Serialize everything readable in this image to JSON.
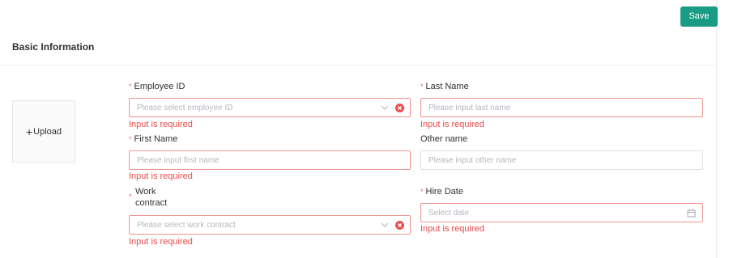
{
  "toolbar": {
    "save_label": "Save"
  },
  "section": {
    "title": "Basic Information"
  },
  "upload": {
    "label": "Upload",
    "icon": "plus-icon"
  },
  "form": {
    "required_mark": "*",
    "employee_id": {
      "label": "Employee ID",
      "placeholder": "Please select employee ID",
      "value": "",
      "error": "Input is required"
    },
    "last_name": {
      "label": "Last Name",
      "placeholder": "Please input last name",
      "value": "",
      "error": "Input is required"
    },
    "first_name": {
      "label": "First Name",
      "placeholder": "Please input first name",
      "value": "",
      "error": "Input is required"
    },
    "other_name": {
      "label": "Other name",
      "placeholder": "Please input other name",
      "value": ""
    },
    "work_contract": {
      "label_line1": "Work",
      "label_line2": "contract",
      "placeholder": "Please select work contract",
      "value": "",
      "error": "Input is required"
    },
    "hire_date": {
      "label": "Hire Date",
      "placeholder": "Select date",
      "value": "",
      "error": "Input is required"
    }
  },
  "colors": {
    "accent": "#1a9b84",
    "error": "#e84a4a",
    "error_border": "#f0938f",
    "placeholder": "#b4b8bf"
  }
}
